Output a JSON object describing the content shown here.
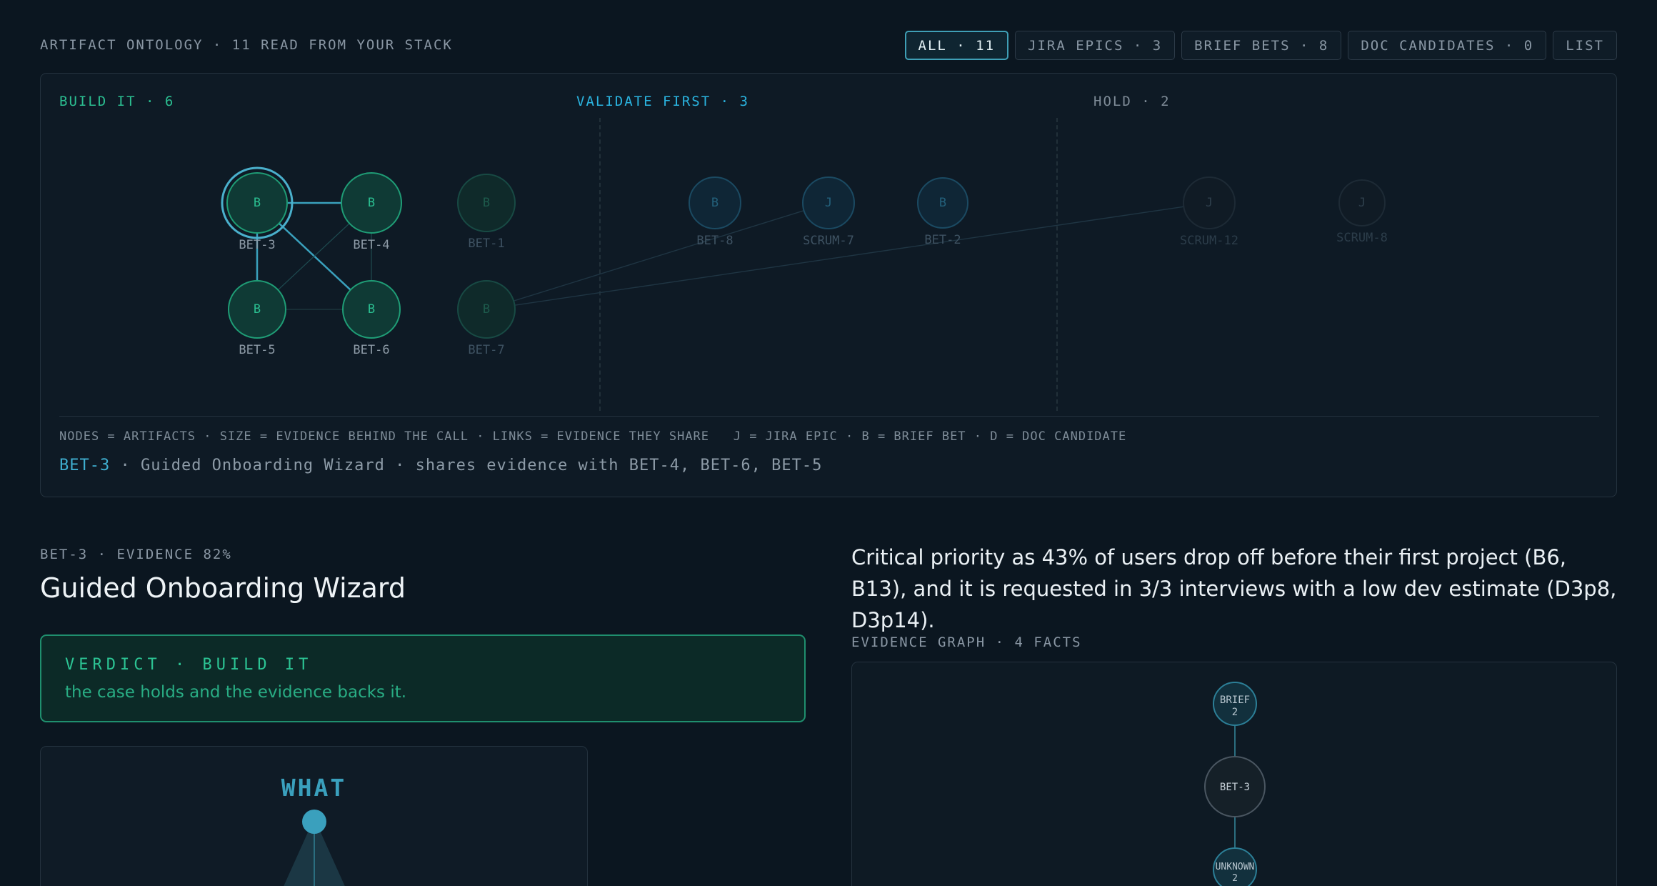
{
  "header": {
    "title": "ARTIFACT ONTOLOGY · 11 READ FROM YOUR STACK",
    "filters": [
      {
        "label": "ALL · 11",
        "active": true
      },
      {
        "label": "JIRA EPICS · 3",
        "active": false
      },
      {
        "label": "BRIEF BETS · 8",
        "active": false
      },
      {
        "label": "DOC CANDIDATES · 0",
        "active": false
      },
      {
        "label": "LIST",
        "active": false
      }
    ]
  },
  "ontology": {
    "groups": {
      "build": "BUILD IT · 6",
      "validate": "VALIDATE FIRST · 3",
      "hold": "HOLD · 2"
    },
    "legend": "NODES = ARTIFACTS · SIZE = EVIDENCE BEHIND THE CALL · LINKS = EVIDENCE THEY SHARE   J = JIRA EPIC · B = BRIEF BET · D = DOC CANDIDATE",
    "selected": {
      "id": "BET-3",
      "text": " · Guided Onboarding Wizard · shares evidence with BET-4, BET-6, BET-5"
    },
    "nodes": [
      {
        "id": "BET-3",
        "glyph": "B",
        "group": "build",
        "selected": true
      },
      {
        "id": "BET-4",
        "glyph": "B",
        "group": "build"
      },
      {
        "id": "BET-1",
        "glyph": "B",
        "group": "build",
        "dim": true
      },
      {
        "id": "BET-5",
        "glyph": "B",
        "group": "build"
      },
      {
        "id": "BET-6",
        "glyph": "B",
        "group": "build"
      },
      {
        "id": "BET-7",
        "glyph": "B",
        "group": "build",
        "dim": true
      },
      {
        "id": "BET-8",
        "glyph": "B",
        "group": "validate"
      },
      {
        "id": "SCRUM-7",
        "glyph": "J",
        "group": "validate"
      },
      {
        "id": "BET-2",
        "glyph": "B",
        "group": "validate"
      },
      {
        "id": "SCRUM-12",
        "glyph": "J",
        "group": "hold"
      },
      {
        "id": "SCRUM-8",
        "glyph": "J",
        "group": "hold"
      }
    ]
  },
  "detail": {
    "meta": "BET-3 · EVIDENCE 82%",
    "title": "Guided Onboarding Wizard",
    "verdict_title": "VERDICT · BUILD IT",
    "verdict_text": "the case holds and the evidence backs it.",
    "what_label": "WHAT"
  },
  "summary": "Critical priority as 43% of users drop off before their first project (B6, B13), and it is requested in 3/3 interviews with a low dev estimate (D3p8, D3p14).",
  "evidence_graph": {
    "title": "EVIDENCE GRAPH · 4 FACTS",
    "nodes": [
      {
        "line1": "BRIEF",
        "line2": "2"
      },
      {
        "line1": "BET-3",
        "line2": ""
      },
      {
        "line1": "UNKNOWN",
        "line2": "2"
      }
    ]
  },
  "colors": {
    "background": "#0b1620",
    "build": "#2bbf91",
    "validate": "#2ab4e0",
    "hold": "#7e8b97",
    "accent": "#3f9fb6"
  }
}
